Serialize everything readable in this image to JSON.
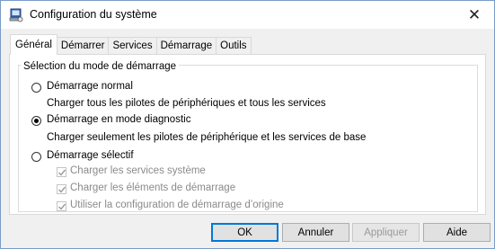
{
  "window": {
    "title": "Configuration du système",
    "close_glyph": "✕",
    "app_icon": "system-config-icon"
  },
  "tabs": [
    {
      "label": "Général",
      "active": true
    },
    {
      "label": "Démarrer",
      "active": false
    },
    {
      "label": "Services",
      "active": false
    },
    {
      "label": "Démarrage",
      "active": false
    },
    {
      "label": "Outils",
      "active": false
    }
  ],
  "startup": {
    "group_label": "Sélection du mode de démarrage",
    "normal": {
      "label": "Démarrage normal",
      "description": "Charger tous les pilotes de périphériques et tous les services",
      "checked": false
    },
    "diagnostic": {
      "label": "Démarrage en mode diagnostic",
      "description": "Charger seulement les pilotes de périphérique et les services de base",
      "checked": true
    },
    "selective": {
      "label": "Démarrage sélectif",
      "checked": false,
      "options": [
        {
          "label": "Charger les services système",
          "checked": true,
          "enabled": false
        },
        {
          "label": "Charger les éléments de démarrage",
          "checked": true,
          "enabled": false
        },
        {
          "label": "Utiliser la configuration de démarrage d’origine",
          "checked": true,
          "enabled": false
        }
      ]
    }
  },
  "buttons": {
    "ok": "OK",
    "cancel": "Annuler",
    "apply": "Appliquer",
    "help": "Aide"
  },
  "colors": {
    "accent": "#0078d7",
    "disabled_text": "#8a8a8a"
  }
}
